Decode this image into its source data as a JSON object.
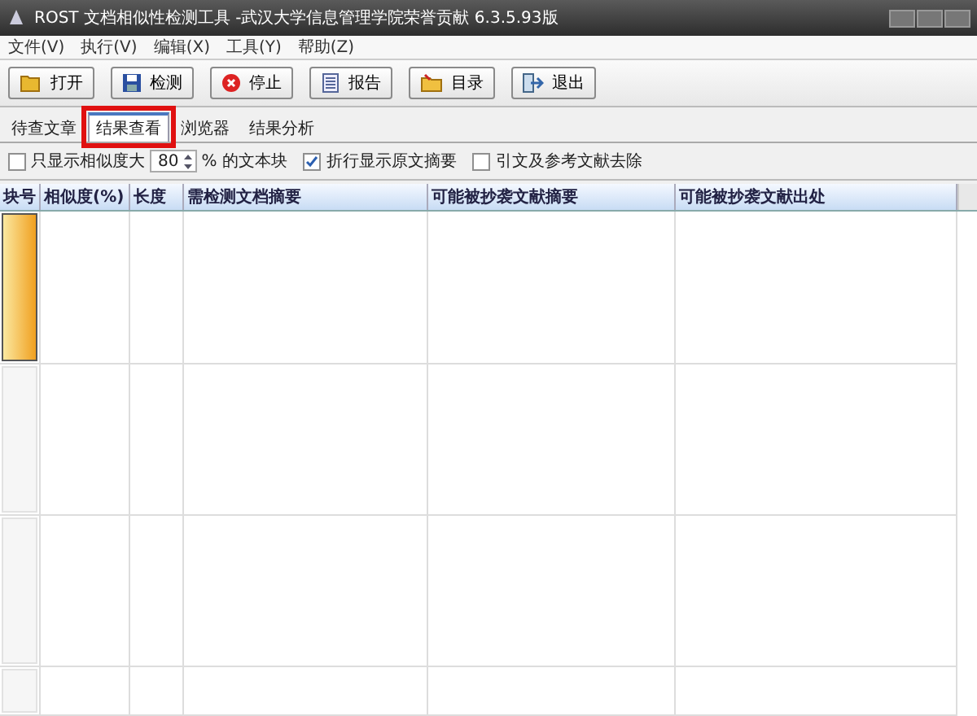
{
  "window": {
    "title": "ROST 文档相似性检测工具 -武汉大学信息管理学院荣誉贡献 6.3.5.93版"
  },
  "menu": [
    "文件(V)",
    "执行(V)",
    "编辑(X)",
    "工具(Y)",
    "帮助(Z)"
  ],
  "toolbar": [
    {
      "label": "打开",
      "kind": "open"
    },
    {
      "label": "检测",
      "kind": "save"
    },
    {
      "label": "停止",
      "kind": "stop"
    },
    {
      "label": "报告",
      "kind": "report"
    },
    {
      "label": "目录",
      "kind": "folder"
    },
    {
      "label": "退出",
      "kind": "exit"
    }
  ],
  "tabs": [
    {
      "label": "待查文章",
      "selected": false,
      "highlighted": false
    },
    {
      "label": "结果查看",
      "selected": true,
      "highlighted": true
    },
    {
      "label": "浏览器",
      "selected": false,
      "highlighted": false
    },
    {
      "label": "结果分析",
      "selected": false,
      "highlighted": false
    }
  ],
  "options": [
    {
      "kind": "threshold",
      "label": "只显示相似度大",
      "value": "80",
      "suffix": "% 的文本块",
      "checked": false
    },
    {
      "kind": "check",
      "label": "折行显示原文摘要",
      "checked": true
    },
    {
      "kind": "check",
      "label": "引文及参考文献去除",
      "checked": false
    }
  ],
  "table": {
    "columns": [
      "块号",
      "相似度(%)",
      "长度",
      "需检测文档摘要",
      "可能被抄袭文献摘要",
      "可能被抄袭文献出处"
    ],
    "rows": [
      {
        "selected": true
      },
      {
        "selected": false
      },
      {
        "selected": false
      },
      {
        "selected": false
      }
    ]
  }
}
